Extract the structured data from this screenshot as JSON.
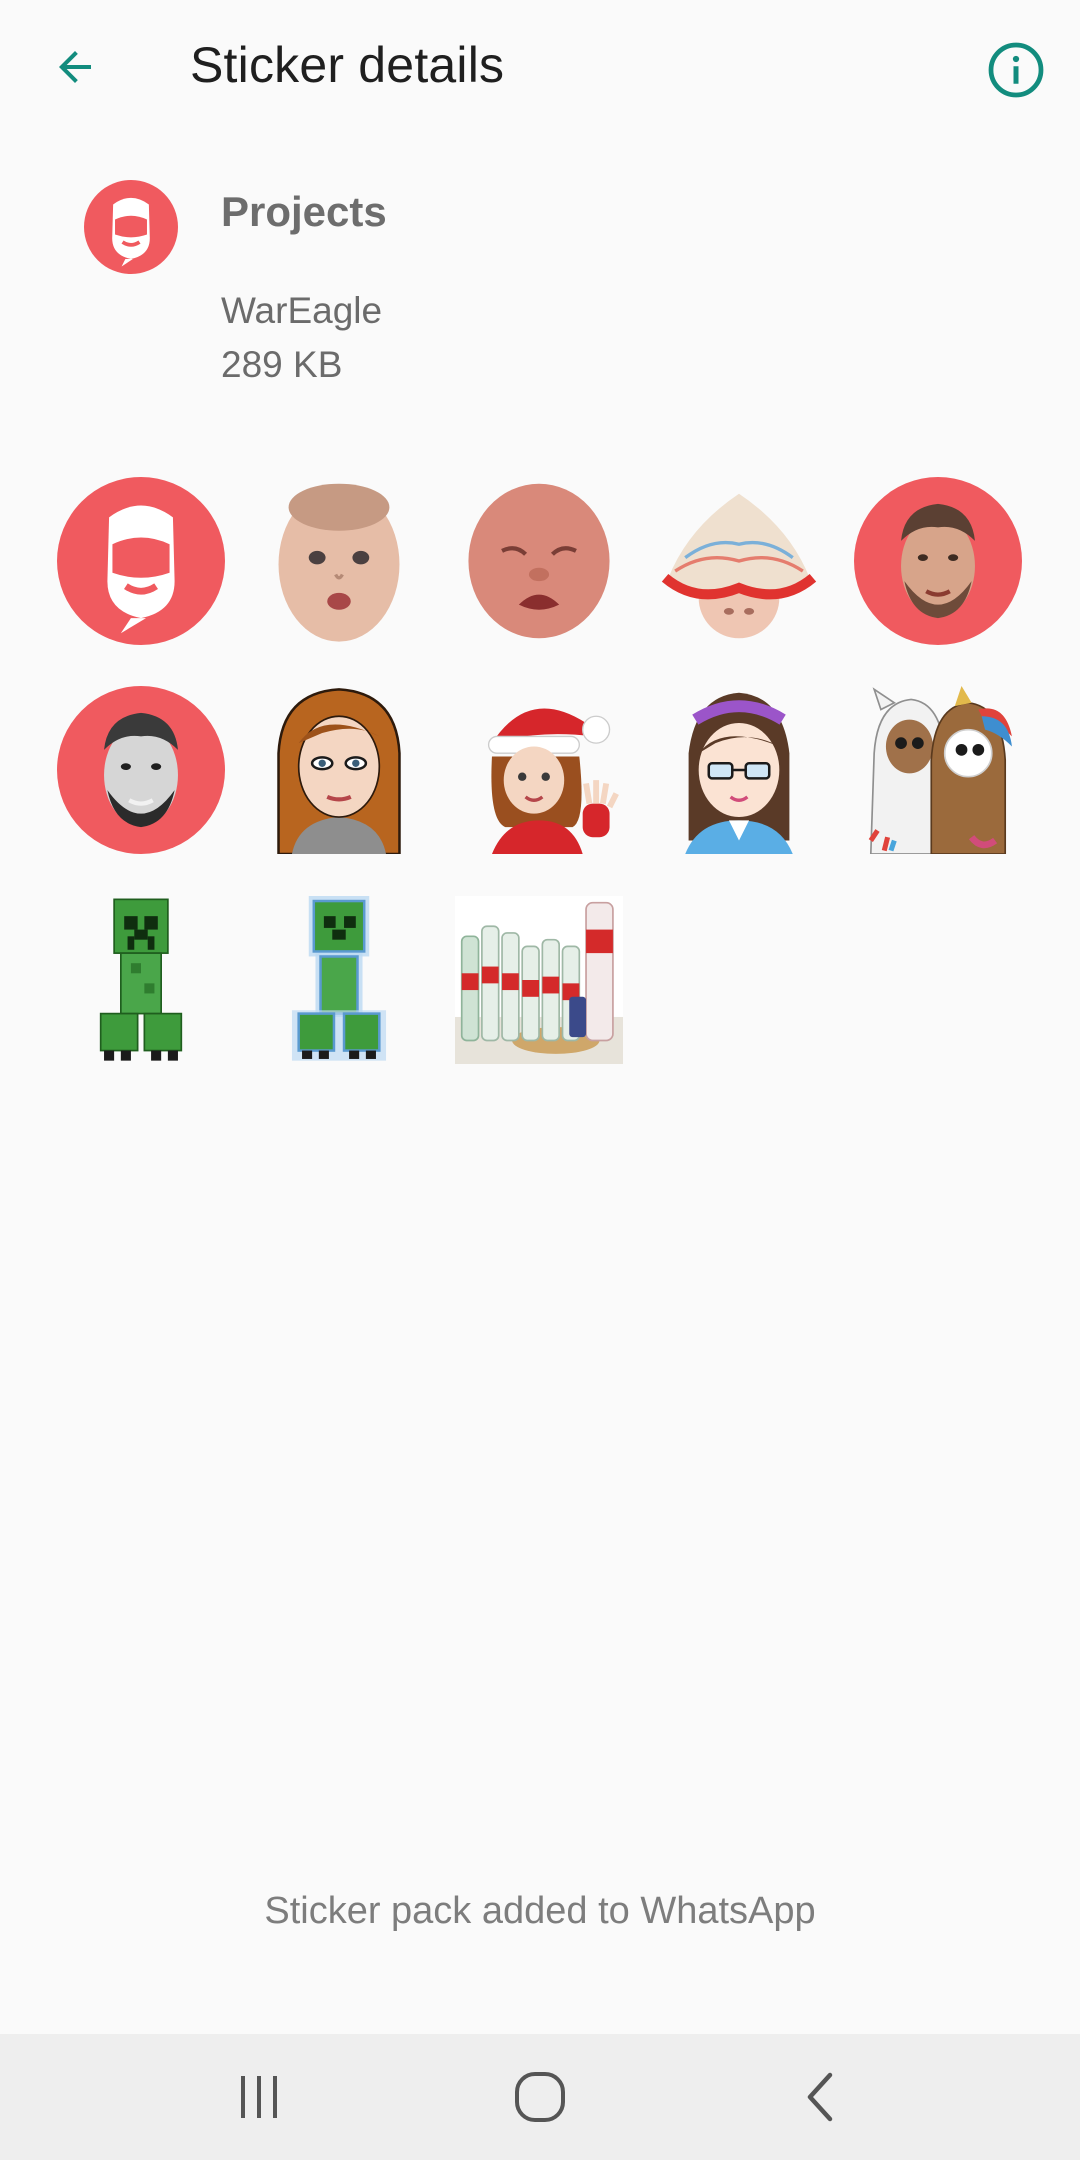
{
  "appbar": {
    "title": "Sticker details",
    "back_icon": "arrow-back-icon",
    "info_icon": "info-icon",
    "accent_color": "#128c7e"
  },
  "pack": {
    "name": "Projects",
    "publisher": "WarEagle",
    "size": "289 KB",
    "tray_icon": "mask-face-icon",
    "brand_color": "#f05a5f"
  },
  "stickers": [
    {
      "icon": "mask-face-sticker"
    },
    {
      "icon": "baby-face-sticker"
    },
    {
      "icon": "crying-baby-sticker"
    },
    {
      "icon": "baby-sunhat-sticker"
    },
    {
      "icon": "man-face-round-sticker"
    },
    {
      "icon": "man-face-bw-round-sticker"
    },
    {
      "icon": "woman-avatar-sticker"
    },
    {
      "icon": "santa-woman-avatar-sticker"
    },
    {
      "icon": "anime-girl-sticker"
    },
    {
      "icon": "groot-unicorn-sticker"
    },
    {
      "icon": "creeper-sticker"
    },
    {
      "icon": "creeper-blue-sticker"
    },
    {
      "icon": "bottles-photo-sticker"
    }
  ],
  "status": {
    "message": "Sticker pack added to WhatsApp"
  },
  "navbar": {
    "recents_icon": "recents-icon",
    "home_icon": "home-icon",
    "back_icon": "back-chevron-icon"
  }
}
